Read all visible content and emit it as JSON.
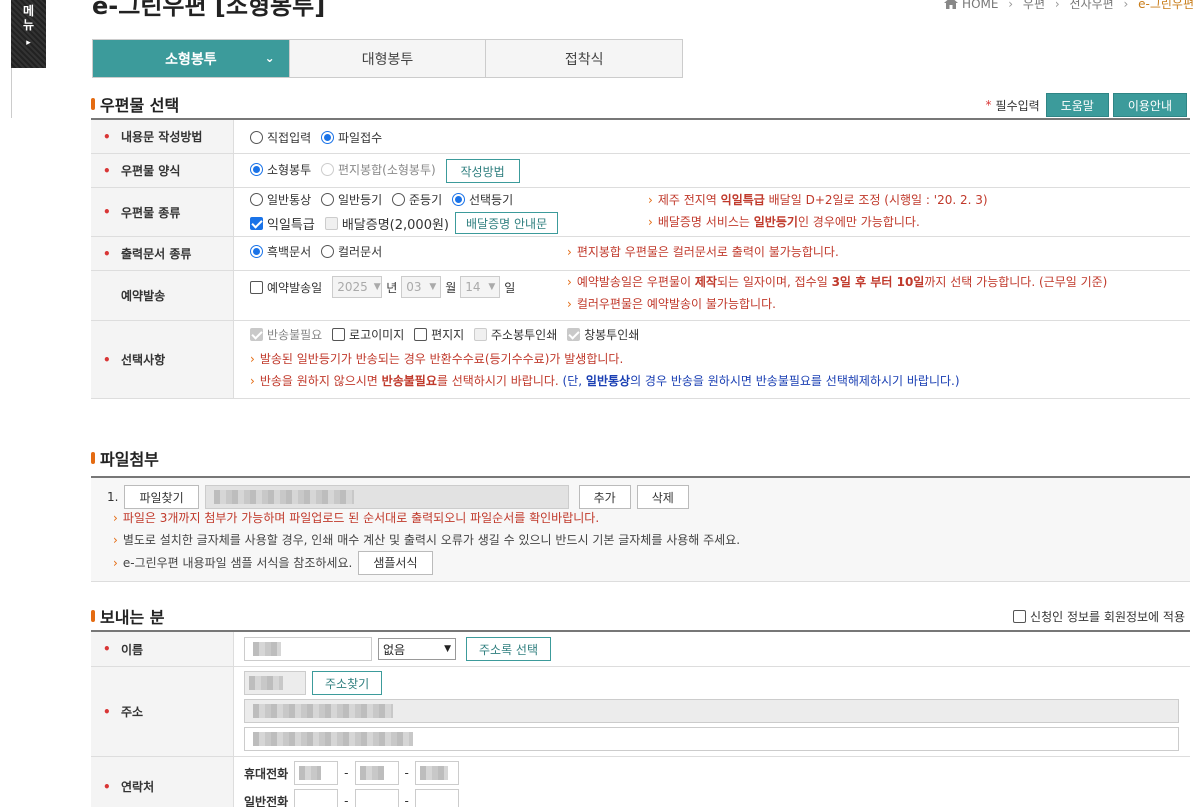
{
  "side_menu": {
    "label_1": "메",
    "label_2": "뉴",
    "arrow": "▸"
  },
  "page": {
    "title": "e-그린우편 [소형봉투]"
  },
  "breadcrumb": {
    "home": "HOME",
    "items": [
      "우편",
      "전자우편",
      "e-그린우편"
    ]
  },
  "tabs": [
    {
      "label": "소형봉투",
      "active": true
    },
    {
      "label": "대형봉투",
      "active": false
    },
    {
      "label": "접착식",
      "active": false
    }
  ],
  "mail_section": {
    "title": "우편물 선택",
    "required_mark": "*",
    "required_text": "필수입력",
    "help_button": "도움말",
    "guide_button": "이용안내",
    "rows": {
      "method": {
        "label": "내용문 작성방법",
        "opt1": "직접입력",
        "opt2": "파일접수"
      },
      "format": {
        "label": "우편물 양식",
        "opt1": "소형봉투",
        "opt2": "편지봉합(소형봉투)",
        "button": "작성방법"
      },
      "kind": {
        "label": "우편물 종류",
        "opt1": "일반통상",
        "opt2": "일반등기",
        "opt3": "준등기",
        "opt4": "선택등기",
        "chk1": "익일특급",
        "chk2": "배달증명(2,000원)",
        "button": "배달증명 안내문",
        "note1_a": "제주 전지역 ",
        "note1_b": "익일특급",
        "note1_c": " 배달일 D+2일로 조정 (시행일 : '20. 2. 3)",
        "note2_a": "배달증명 서비스는 ",
        "note2_b": "일반등기",
        "note2_c": "인 경우에만 가능합니다."
      },
      "print": {
        "label": "출력문서 종류",
        "opt1": "흑백문서",
        "opt2": "컬러문서",
        "note": "편지봉합 우편물은 컬러문서로 출력이 불가능합니다."
      },
      "reserve": {
        "label": "예약발송",
        "chk": "예약발송일",
        "year": "2025",
        "year_unit": "년",
        "month": "03",
        "month_unit": "월",
        "day": "14",
        "day_unit": "일",
        "note1_a": "예약발송일은 우편물이 ",
        "note1_b": "제작",
        "note1_c": "되는 일자이며, 접수일 ",
        "note1_d": "3일 후 부터 10일",
        "note1_e": "까지 선택 가능합니다. (근무일 기준)",
        "note2": "컬러우편물은 예약발송이 불가능합니다."
      },
      "options": {
        "label": "선택사항",
        "chk1": "반송불필요",
        "chk2": "로고이미지",
        "chk3": "편지지",
        "chk4": "주소봉투인쇄",
        "chk5": "창봉투인쇄",
        "note1": "발송된 일반등기가 반송되는 경우 반환수수료(등기수수료)가 발생합니다.",
        "note2_a": "반송을 원하지 않으시면 ",
        "note2_b": "반송불필요",
        "note2_c": "를 선택하시기 바랍니다. ",
        "note2_d": "(단, ",
        "note2_e": "일반통상",
        "note2_f": "의 경우 반송을 원하시면 반송불필요를 선택해제하시기 바랍니다.)"
      }
    }
  },
  "file_section": {
    "title": "파일첨부",
    "index": "1.",
    "find_button": "파일찾기",
    "add_button": "추가",
    "delete_button": "삭제",
    "note1": "파일은 3개까지 첨부가 가능하며 파일업로드 된 순서대로 출력되오니 파일순서를 확인바랍니다.",
    "note2": "별도로 설치한 글자체를 사용할 경우, 인쇄 매수 계산 및 출력시 오류가 생길 수 있으니 반드시 기본 글자체를 사용해 주세요.",
    "note3": "e-그린우편 내용파일 샘플 서식을 참조하세요.",
    "sample_button": "샘플서식"
  },
  "sender_section": {
    "title": "보내는 분",
    "member_check": "신청인 정보를 회원정보에 적용",
    "name_label": "이름",
    "name_select": "없음",
    "address_book_button": "주소록 선택",
    "address_label": "주소",
    "address_search_button": "주소찾기",
    "contact_label": "연락처",
    "mobile_label": "휴대전화",
    "phone_label": "일반전화",
    "dash": "-"
  }
}
